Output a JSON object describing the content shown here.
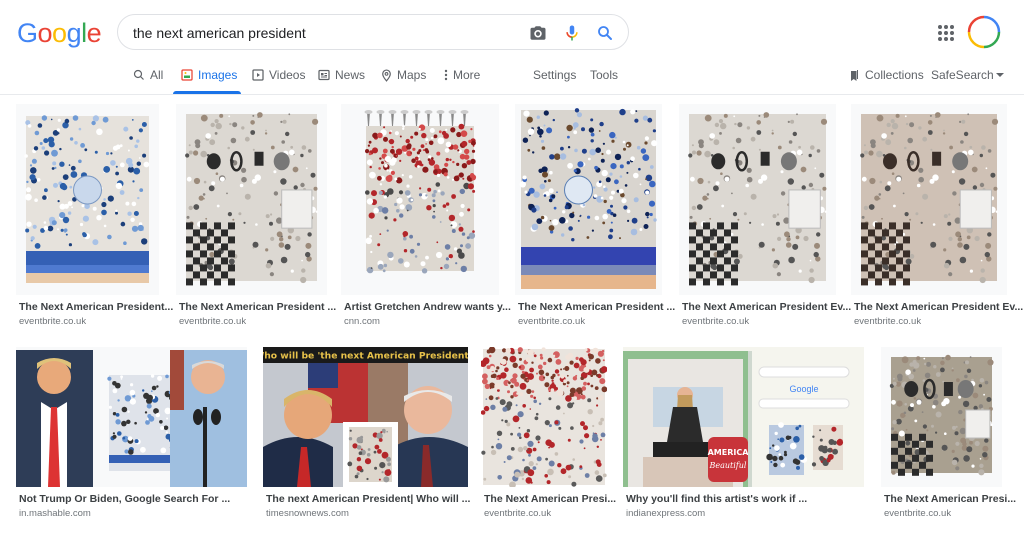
{
  "header": {
    "logo_letters": [
      {
        "char": "G",
        "color": "#4285f4"
      },
      {
        "char": "o",
        "color": "#ea4335"
      },
      {
        "char": "o",
        "color": "#fbbc05"
      },
      {
        "char": "g",
        "color": "#4285f4"
      },
      {
        "char": "l",
        "color": "#34a853"
      },
      {
        "char": "e",
        "color": "#ea4335"
      }
    ],
    "search_query": "the next american president",
    "icons": [
      "camera-icon",
      "microphone-icon",
      "search-icon"
    ]
  },
  "tabs": [
    {
      "label": "All",
      "icon": "search-icon",
      "active": false
    },
    {
      "label": "Images",
      "icon": "image-icon",
      "active": true
    },
    {
      "label": "Videos",
      "icon": "video-icon",
      "active": false
    },
    {
      "label": "News",
      "icon": "news-icon",
      "active": false
    },
    {
      "label": "Maps",
      "icon": "map-pin-icon",
      "active": false
    },
    {
      "label": "More",
      "icon": "more-vert-icon",
      "active": false
    }
  ],
  "tools": {
    "settings": "Settings",
    "tools": "Tools",
    "collections": "Collections",
    "safesearch": "SafeSearch"
  },
  "accent_color": "#1a73e8",
  "results": [
    {
      "title": "The Next American President...",
      "source": "eventbrite.co.uk",
      "image": "blue mosaic artwork"
    },
    {
      "title": "The Next American President ...",
      "source": "eventbrite.co.uk",
      "image": "grey still-life mosaic artwork"
    },
    {
      "title": "Artist Gretchen Andrew wants y...",
      "source": "cnn.com",
      "image": "red roses mosaic artwork"
    },
    {
      "title": "The Next American President ...",
      "source": "eventbrite.co.uk",
      "image": "blue mosaic artwork close-up"
    },
    {
      "title": "The Next American President Ev...",
      "source": "eventbrite.co.uk",
      "image": "still-life mosaic artwork"
    },
    {
      "title": "The Next American President Ev...",
      "source": "eventbrite.co.uk",
      "image": "sepia still-life mosaic artwork"
    },
    {
      "title": "Not Trump Or Biden, Google Search For ...",
      "source": "in.mashable.com",
      "image": "Trump, artwork, Biden collage"
    },
    {
      "title": "The next American President| Who will ...",
      "source": "timesnownews.com",
      "image": "Trump and Biden with artwork",
      "overlay_text": "Who will be 'the next American President'?"
    },
    {
      "title": "The Next American Presi...",
      "source": "eventbrite.co.uk",
      "image": "red roses artwork angled"
    },
    {
      "title": "Why you'll find this artist's work if ...",
      "source": "indianexpress.com",
      "image": "artist with Google search screenshot",
      "overlay_text": "AMERICA Beautiful",
      "embedded_logo": "Google"
    },
    {
      "title": "The Next American Presi...",
      "source": "eventbrite.co.uk",
      "image": "still-life artwork angled"
    }
  ]
}
